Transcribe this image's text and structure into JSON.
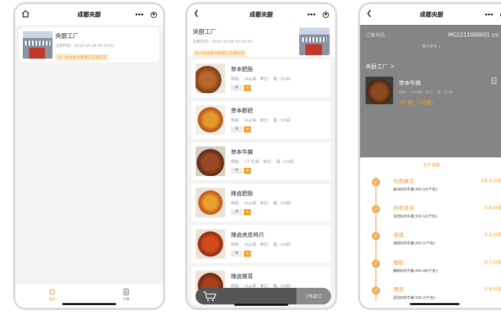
{
  "app": {
    "title": "成都央厨"
  },
  "screen1": {
    "kitchen": {
      "name": "央厨工厂",
      "registered": "注册时间：2020-10-26 07:03:01",
      "address": "四川省成都市郫都区安德街道"
    },
    "tabs": [
      {
        "label": "首页",
        "icon": "home-icon"
      },
      {
        "label": "订单",
        "icon": "order-icon"
      }
    ]
  },
  "screen2": {
    "kitchen": {
      "name": "央厨工厂",
      "registered": "注册时间：2020-10-26 07:03:01",
      "address": "四川省成都市郫都区安德街道"
    },
    "items": [
      {
        "name": "草本肥肠",
        "spec": "规格：　1kg/袋　单位：　箱（10袋）",
        "qty": "0"
      },
      {
        "name": "草本郡把",
        "spec": "规格：　1kg/袋　单位：　箱（10袋）",
        "qty": "0"
      },
      {
        "name": "草本牛腩",
        "spec": "规格：　1千克/袋　单位：　箱（10袋）",
        "qty": "0"
      },
      {
        "name": "辣卤肥肠",
        "spec": "规格：　1kg/袋　单位：　箱（10袋）",
        "qty": "0"
      },
      {
        "name": "辣卤虎皮鸡爪",
        "spec": "规格：　1kg/袋　单位：　箱（10袋）",
        "qty": "0"
      },
      {
        "name": "辣卤猪耳",
        "spec": "规格：　1kg/袋　单位：　箱（10袋）",
        "qty": "0"
      }
    ],
    "cart": {
      "min_order": "1件起订"
    }
  },
  "screen3": {
    "order": {
      "label": "订单号码",
      "number": "MO2211000001",
      "copy": "复制",
      "expand": "展开更多 ∨"
    },
    "kitchen_link": "央厨工厂 ＞",
    "item": {
      "name": "草本牛腩",
      "spec": "规格：　1kg/袋　单位：　箱（10袋）",
      "qty": "30 箱（10袋）"
    },
    "progress": {
      "title": "生产进度",
      "steps": [
        {
          "name": "肉类解冻",
          "detail": "解冻好的牛腩:350.02(千克);",
          "hours": "16.2小时"
        },
        {
          "name": "肉类清洗",
          "detail": "清洗好的牛腩:330.12(千克);",
          "hours": "0.8小时"
        },
        {
          "name": "滚揉",
          "detail": "滚揉好的牛腩:350.1(千克);",
          "hours": "2.2小时"
        },
        {
          "name": "腌制",
          "detail": "腌制好的牛腩:350.08(千克);",
          "hours": "0.7小时"
        },
        {
          "name": "漂烫",
          "detail": "漂烫好的牛腩:330.2(千克);",
          "hours": "0.8小时"
        }
      ]
    }
  },
  "colors": {
    "accent": "#f0a030",
    "accent_bg": "#fdf0dc"
  }
}
